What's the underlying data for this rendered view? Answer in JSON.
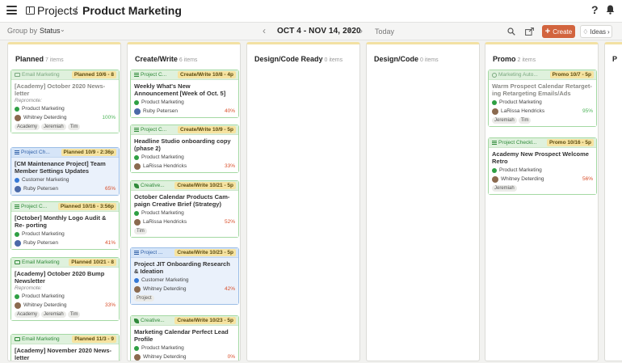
{
  "header": {
    "breadcrumb_root": "Projects",
    "breadcrumb_sep": "/",
    "breadcrumb_current": "Product Marketing",
    "help": "?"
  },
  "toolbar": {
    "group_by_label": "Group by",
    "group_by_value": "Status",
    "date_range": "OCT 4 - NOV 14, 2020",
    "today": "Today",
    "create": "Create",
    "ideas": "Ideas"
  },
  "columns": [
    {
      "title": "Planned",
      "count": "7 items"
    },
    {
      "title": "Create/Write",
      "count": "6 items"
    },
    {
      "title": "Design/Code Ready",
      "count": "0 items"
    },
    {
      "title": "Design/Code",
      "count": "0 items"
    },
    {
      "title": "Promo",
      "count": "2 items"
    },
    {
      "title": "P",
      "count": ""
    }
  ],
  "cards": {
    "planned": [
      {
        "type": "Email Marketing",
        "status": "Planned 10/6 - 8",
        "title": "[Academy] October 2020 News- letter",
        "repromote": "Repromote:",
        "project": "Product Marketing",
        "person": "Whitney Deterding",
        "pct": "100%",
        "tags": [
          "Academy",
          "Jeremiah",
          "Tim"
        ]
      },
      {
        "type": "Project Ch...",
        "status": "Planned 10/9 - 2:36p",
        "title": "[CM Maintenance Project] Team Member Settings Updates",
        "project": "Customer Marketing",
        "person": "Ruby Petersen",
        "pct": "65%"
      },
      {
        "type": "Project C...",
        "status": "Planned 10/16 - 3:56p",
        "title": "[October] Monthly Logo Audit & Re- porting",
        "project": "Product Marketing",
        "person": "Ruby Petersen",
        "pct": "41%"
      },
      {
        "type": "Email Marketing",
        "status": "Planned 10/21 - 8",
        "title": "[Academy] October 2020 Bump Newsletter",
        "repromote": "Repromote:",
        "project": "Product Marketing",
        "person": "Whitney Deterding",
        "pct": "33%",
        "tags": [
          "Academy",
          "Jeremiah",
          "Tim"
        ]
      },
      {
        "type": "Email Marketing",
        "status": "Planned 11/3 - 9",
        "title": "[Academy] November 2020 News- letter"
      }
    ],
    "create": [
      {
        "type": "Project C...",
        "status": "Create/Write 10/8 - 4p",
        "title": "Weekly What's New Announcement [Week of Oct. 5]",
        "project": "Product Marketing",
        "person": "Ruby Petersen",
        "pct": "40%"
      },
      {
        "type": "Project C...",
        "status": "Create/Write 10/9 - 5p",
        "title": "Headline Studio onboarding copy (phase 2)",
        "project": "Product Marketing",
        "person": "LaRissa Hendricks",
        "pct": "33%"
      },
      {
        "type": "Creative...",
        "status": "Create/Write 10/21 - 5p",
        "title": "October Calendar Products Cam- paign Creative Brief (Strategy)",
        "project": "Product Marketing",
        "person": "LaRissa Hendricks",
        "pct": "52%",
        "tags": [
          "Tim"
        ]
      },
      {
        "type": "Project ...",
        "status": "Create/Write 10/23 - 5p",
        "title": "Project JIT Onboarding Research & Ideation",
        "project": "Customer Marketing",
        "person": "Whitney Deterding",
        "pct": "42%",
        "tags": [
          "Project"
        ]
      },
      {
        "type": "Creative...",
        "status": "Create/Write 10/23 - 5p",
        "title": "Marketing Calendar Perfect Lead Profile",
        "project": "Product Marketing",
        "person": "Whitney Deterding",
        "pct": "0%"
      }
    ],
    "promo": [
      {
        "type": "Marketing Auto...",
        "status": "Promo 10/7 - 5p",
        "title": "Warm Prospect Calendar Retarget- ing Retargeting Emails/Ads",
        "project": "Product Marketing",
        "person": "LaRissa Hendricks",
        "pct": "95%",
        "tags": [
          "Jeremiah",
          "Tim"
        ]
      },
      {
        "type": "Project Checkl...",
        "status": "Promo 10/16 - 5p",
        "title": "Academy New Prospect Welcome Retro",
        "project": "Product Marketing",
        "person": "Whitney Deterding",
        "pct": "56%",
        "tags": [
          "Jeremiah"
        ]
      }
    ]
  }
}
